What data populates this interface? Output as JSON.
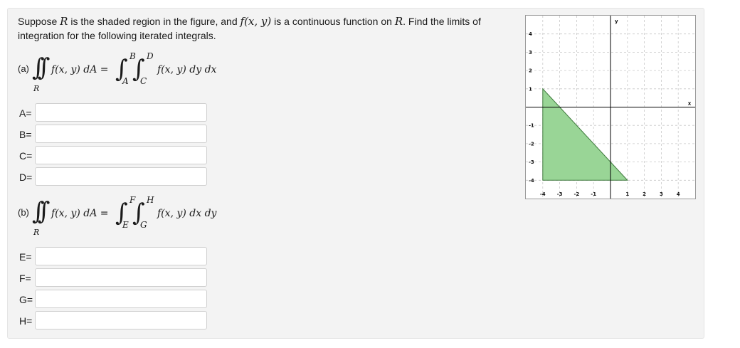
{
  "prompt": {
    "text_1": "Suppose ",
    "var_R": "R",
    "text_2": " is the shaded region in the figure, and ",
    "func": "f(x, y)",
    "text_3": " is a continuous function on ",
    "var_R2": "R",
    "text_4": ". Find the limits of integration for the following iterated integrals."
  },
  "part_a": {
    "label": "(a)",
    "lhs": "f(x, y) dA =",
    "region": "R",
    "outer_upper": "B",
    "outer_lower": "A",
    "inner_upper": "D",
    "inner_lower": "C",
    "rhs": "f(x, y) dy dx",
    "fields": [
      {
        "label": "A=",
        "value": ""
      },
      {
        "label": "B=",
        "value": ""
      },
      {
        "label": "C=",
        "value": ""
      },
      {
        "label": "D=",
        "value": ""
      }
    ]
  },
  "part_b": {
    "label": "(b)",
    "lhs": "f(x, y) dA =",
    "region": "R",
    "outer_upper": "F",
    "outer_lower": "E",
    "inner_upper": "H",
    "inner_lower": "G",
    "rhs": "f(x, y) dx dy",
    "fields": [
      {
        "label": "E=",
        "value": ""
      },
      {
        "label": "F=",
        "value": ""
      },
      {
        "label": "G=",
        "value": ""
      },
      {
        "label": "H=",
        "value": ""
      }
    ]
  },
  "graph": {
    "x_axis_label": "x",
    "y_axis_label": "y",
    "x_range": [
      -5,
      5
    ],
    "y_range": [
      -5,
      5
    ],
    "x_ticks": [
      "-4",
      "-3",
      "-2",
      "-1",
      "1",
      "2",
      "3",
      "4"
    ],
    "y_ticks": [
      "4",
      "3",
      "2",
      "1",
      "-1",
      "-2",
      "-3",
      "-4"
    ],
    "region_vertices": [
      [
        -4,
        1
      ],
      [
        -4,
        -4
      ],
      [
        1,
        -4
      ]
    ],
    "region_fill": "#99d596",
    "region_stroke": "#3e7a3c",
    "grid_color": "#c8c8c8",
    "axis_color": "#000000"
  }
}
